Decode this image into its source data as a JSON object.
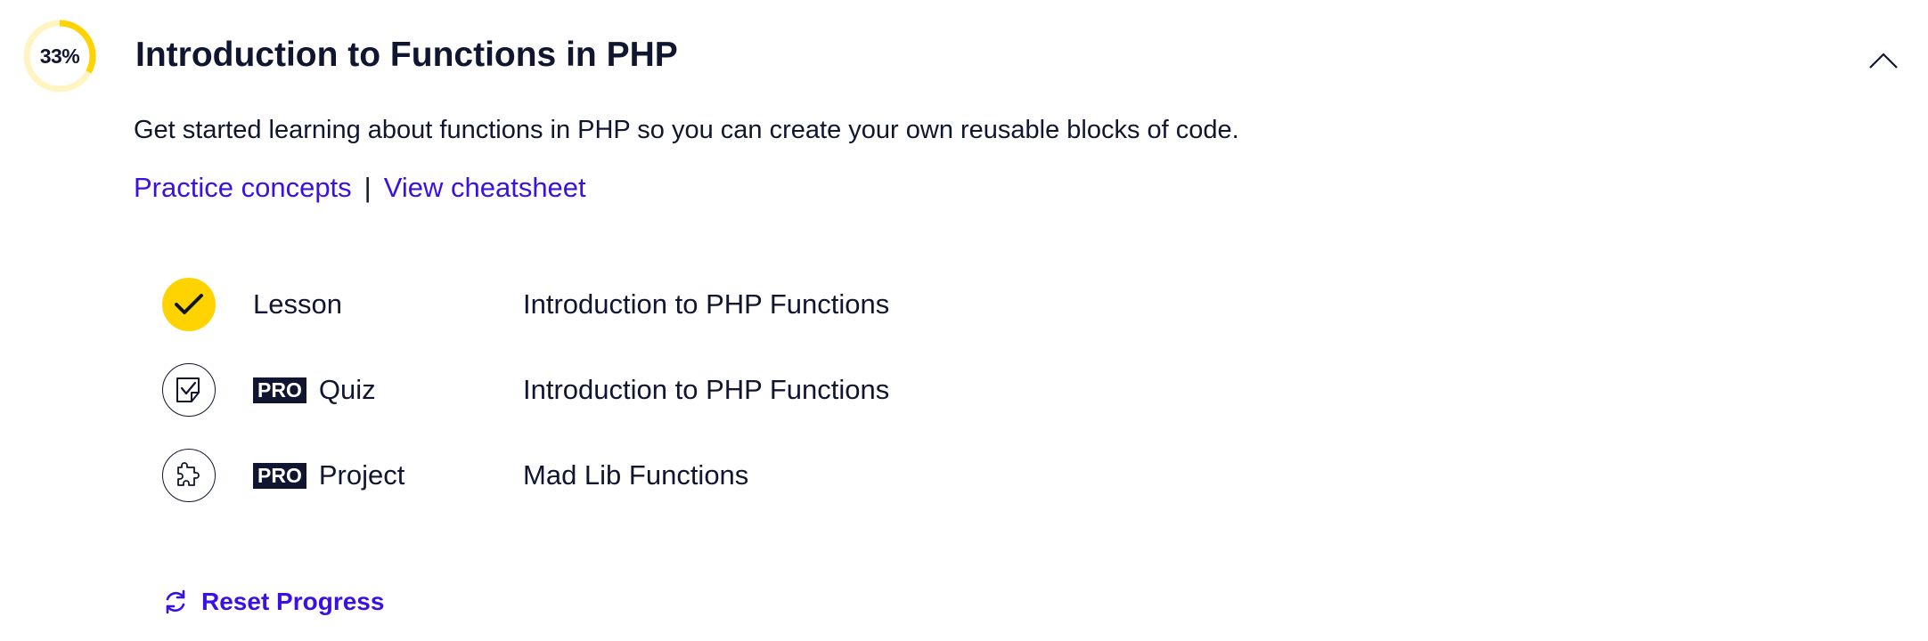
{
  "module": {
    "progress_percent": 33,
    "progress_label": "33%",
    "title": "Introduction to Functions in PHP",
    "description": "Get started learning about functions in PHP so you can create your own reusable blocks of code.",
    "links": {
      "practice": "Practice concepts",
      "separator": "|",
      "cheatsheet": "View cheatsheet"
    },
    "items": [
      {
        "type": "Lesson",
        "pro": false,
        "completed": true,
        "icon": "checkmark-icon",
        "title": "Introduction to PHP Functions"
      },
      {
        "type": "Quiz",
        "pro": true,
        "pro_label": "PRO",
        "completed": false,
        "icon": "quiz-icon",
        "title": "Introduction to PHP Functions"
      },
      {
        "type": "Project",
        "pro": true,
        "pro_label": "PRO",
        "completed": false,
        "icon": "puzzle-icon",
        "title": "Mad Lib Functions"
      }
    ],
    "reset_label": "Reset Progress",
    "colors": {
      "accent_link": "#3a10e5",
      "progress": "#ffd300",
      "progress_track": "#fff4c2",
      "text": "#10162f"
    }
  }
}
